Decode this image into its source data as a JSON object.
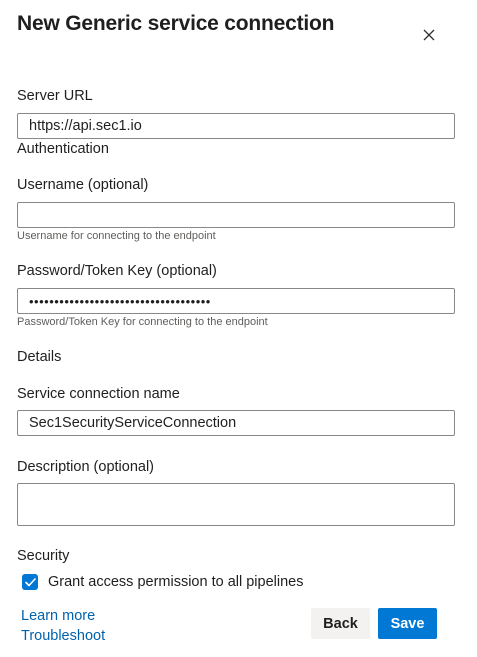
{
  "dialog": {
    "title": "New Generic service connection",
    "close_icon": "close-icon"
  },
  "server_url": {
    "label": "Server URL",
    "value": "https://api.sec1.io"
  },
  "authentication": {
    "heading": "Authentication",
    "username": {
      "label": "Username (optional)",
      "value": "",
      "hint": "Username for connecting to the endpoint"
    },
    "password": {
      "label": "Password/Token Key (optional)",
      "value": "••••••••••••••••••••••••••••••••••••",
      "hint": "Password/Token Key for connecting to the endpoint"
    }
  },
  "details": {
    "heading": "Details",
    "connection_name": {
      "label": "Service connection name",
      "value": "Sec1SecurityServiceConnection"
    },
    "description": {
      "label": "Description (optional)",
      "value": ""
    }
  },
  "security": {
    "heading": "Security",
    "grant_access": {
      "label": "Grant access permission to all pipelines",
      "checked": true
    }
  },
  "footer": {
    "learn_more": "Learn more",
    "troubleshoot": "Troubleshoot",
    "back_label": "Back",
    "save_label": "Save"
  },
  "colors": {
    "accent": "#0078d4",
    "link": "#0062ad",
    "border": "#8a8886",
    "hint": "#605e5c"
  }
}
